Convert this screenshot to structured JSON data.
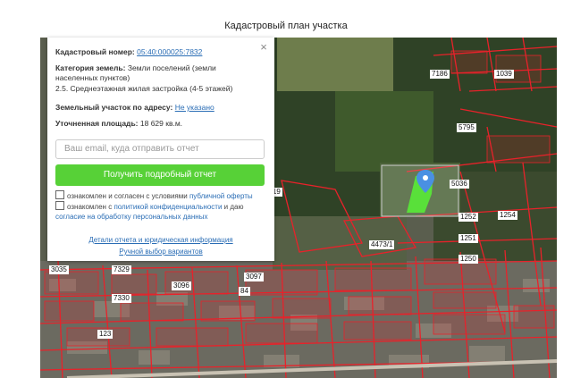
{
  "page": {
    "title": "Кадастровый план участка"
  },
  "panel": {
    "cadastral_label": "Кадастровый номер:",
    "cadastral_value": "05:40:000025:7832",
    "category_label": "Категория земель:",
    "category_value": "Земли поселений (земли населенных пунктов)",
    "usage_value": "2.5. Среднеэтажная жилая застройка (4-5 этажей)",
    "address_label": "Земельный участок по адресу:",
    "address_value": "Не указано",
    "area_label": "Уточненная площадь:",
    "area_value": "18 629 кв.м.",
    "email_placeholder": "Ваш email, куда отправить отчет",
    "cta_label": "Получить подробный отчет",
    "consent1_text": "ознакомлен и согласен с условиями",
    "consent1_link": "публичной оферты",
    "consent2_text": "ознакомлен с",
    "consent2_link1": "политикой конфиденциальности",
    "consent2_and": "и даю",
    "consent2_link2": "согласие на обработку персональных данных",
    "details_link": "Детали отчета и юридическая информация",
    "manual_link": "Ручной выбор вариантов",
    "close_symbol": "×"
  },
  "map": {
    "parcel_labels": [
      "7186",
      "1039",
      "5795",
      "5036",
      "1919",
      "1252",
      "1254",
      "4473/1",
      "1251",
      "1250",
      "3035",
      "7329",
      "7330",
      "3096",
      "3097",
      "84",
      "123"
    ],
    "marker_color": "#4a90e2",
    "selected_parcel_color": "#59e03a",
    "boundary_color": "#e8222a"
  }
}
